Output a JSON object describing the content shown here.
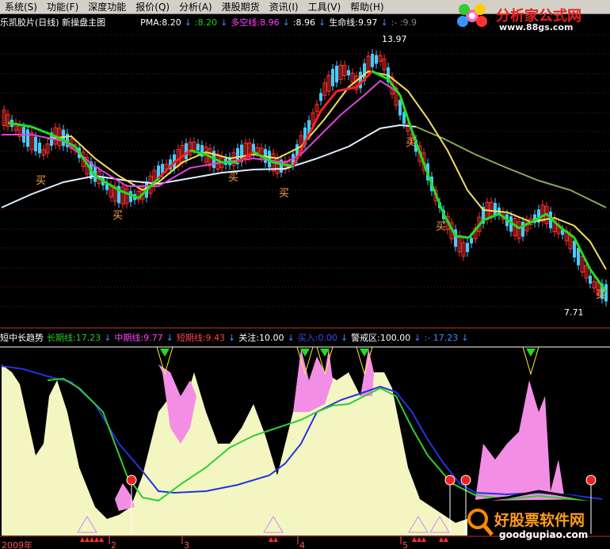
{
  "menu": [
    "系统(S)",
    "功能(F)",
    "深度功能",
    "报价(Q)",
    "分析(A)",
    "港股期货",
    "资讯(I)",
    "工具(V)",
    "帮助(H)"
  ],
  "main_panel": {
    "stock_title": "乐凯胶片(日线) 新操盘主图",
    "pma_label": "PMA:8.20",
    "pma_value2": ":8.20",
    "duokong_label": "多空线:8.96",
    "value3": ":8.96",
    "shengming_label": "生命线:9.97",
    "value4": ":-  :9.9",
    "high_label": "13.97",
    "low_label": "7.71",
    "buy_signal": "买",
    "colors": {
      "pma": "#ffffff",
      "duokong": "#ff44ff",
      "shengming": "#ffffff",
      "up": "#ff3030",
      "down": "#44ccff"
    }
  },
  "sub_panel": {
    "title": "短中长趋势",
    "long_label": "长期线:17.23",
    "mid_label": "中期线:9.77",
    "short_label": "短期线:9.43",
    "attention_label": "关注:10.00",
    "buy_label": "买入:0.00",
    "warning_label": "警戒区:100.00",
    "extra_label": ":-  17.23",
    "colors": {
      "long": "#22cc22",
      "mid": "#ff44ff",
      "short": "#ff4444",
      "attention": "#ffffff",
      "buy": "#4444ff",
      "warning": "#ffffff",
      "extra": "#4488ff"
    }
  },
  "time_axis": {
    "year_label": "2009年",
    "months": [
      "2",
      "3",
      "4",
      "5"
    ]
  },
  "logo_top": {
    "brand": "分析家公式网",
    "url": "www.88gs.com"
  },
  "logo_bottom": {
    "brand": "好股票软件网",
    "url": "goodgupiao.com"
  }
}
